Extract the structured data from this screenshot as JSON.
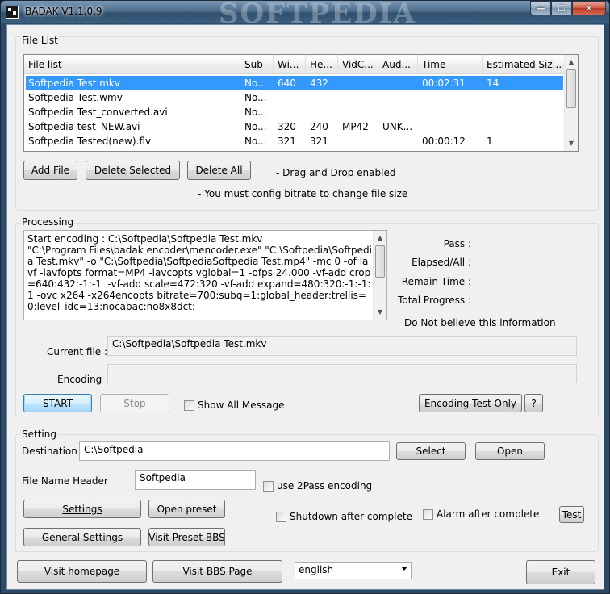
{
  "window": {
    "title": "BADAK V1.1.0.9",
    "watermark": "SOFTPEDIA",
    "min_symbol": "—",
    "max_symbol": "☐",
    "close_symbol": "✕"
  },
  "file_list": {
    "group_label": "File List",
    "columns": [
      "File list",
      "Sub",
      "Wi...",
      "He...",
      "VidC...",
      "Aud...",
      "Time",
      "Estimated Siz..."
    ],
    "rows": [
      [
        "Softpedia Test.mkv",
        "No...",
        "640",
        "432",
        "",
        "",
        "00:02:31",
        "14"
      ],
      [
        "Softpedia Test.wmv",
        "No...",
        "",
        "",
        "",
        "",
        "",
        ""
      ],
      [
        "Softpedia Test_converted.avi",
        "No...",
        "",
        "",
        "",
        "",
        "",
        ""
      ],
      [
        "Softpedia test_NEW.avi",
        "No...",
        "320",
        "240",
        "MP42",
        "UNK...",
        "",
        ""
      ],
      [
        "Softpedia Tested(new).flv",
        "No...",
        "321",
        "321",
        "",
        "",
        "00:00:12",
        "1"
      ]
    ],
    "add_file": "Add File",
    "delete_selected": "Delete Selected",
    "delete_all": "Delete All",
    "drag_drop_note": "- Drag and Drop enabled",
    "bitrate_note": "- You must config bitrate to change file size"
  },
  "processing": {
    "group_label": "Processing",
    "log": "Start encoding : C:\\Softpedia\\Softpedia Test.mkv\n\"C:\\Program Files\\badak encoder\\mencoder.exe\" \"C:\\Softpedia\\Softpedia Test.mkv\" -o \"C:\\Softpedia\\SoftpediaSoftpedia Test.mp4\" -mc 0 -of lavf -lavfopts format=MP4 -lavcopts vglobal=1 -ofps 24.000 -vf-add crop=640:432:-1:-1  -vf-add scale=472:320 -vf-add expand=480:320:-1:-1:1 -ovc x264 -x264encopts bitrate=700:subq=1:global_header:trellis=0:level_idc=13:nocabac:no8x8dct:",
    "pass_label": "Pass :",
    "elapsed_label": "Elapsed/All :",
    "remain_label": "Remain Time :",
    "total_label": "Total Progress :",
    "disclaimer": "Do Not believe this information",
    "current_file_label": "Current file :",
    "current_file_value": "C:\\Softpedia\\Softpedia Test.mkv",
    "encoding_label": "Encoding",
    "start": "START",
    "stop": "Stop",
    "show_all_message": "Show All Message",
    "encoding_test_only": "Encoding Test Only",
    "help": "?"
  },
  "setting": {
    "group_label": "Setting",
    "destination_label": "Destination",
    "destination_value": "C:\\Softpedia",
    "select": "Select",
    "open": "Open",
    "file_name_header_label": "File Name Header",
    "file_name_header_value": "Softpedia",
    "use_2pass": "use 2Pass encoding",
    "settings": "Settings",
    "open_preset": "Open preset",
    "shutdown_after_complete": "Shutdown after complete",
    "alarm_after_complete": "Alarm after complete",
    "test": "Test",
    "general_settings": "General Settings",
    "visit_preset_bbs": "Visit Preset BBS"
  },
  "footer": {
    "visit_homepage": "Visit homepage",
    "visit_bbs_page": "Visit BBS Page",
    "language": "english",
    "exit": "Exit"
  }
}
